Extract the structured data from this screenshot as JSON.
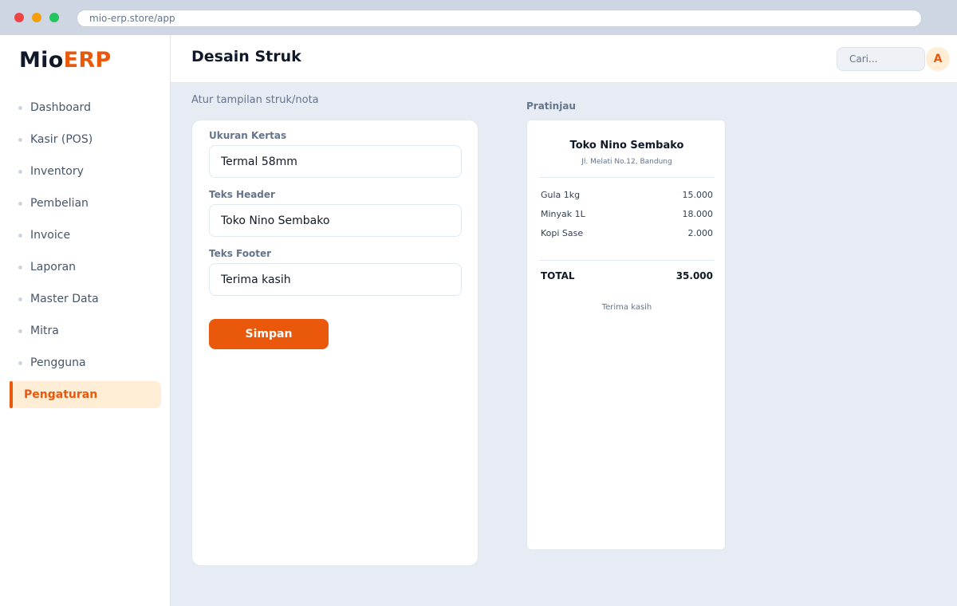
{
  "browser": {
    "url": "mio-erp.store/app"
  },
  "logo": {
    "part1": "Mio",
    "part2": "ERP"
  },
  "sidebar": {
    "items": [
      {
        "label": "Dashboard"
      },
      {
        "label": "Kasir (POS)"
      },
      {
        "label": "Inventory"
      },
      {
        "label": "Pembelian"
      },
      {
        "label": "Invoice"
      },
      {
        "label": "Laporan"
      },
      {
        "label": "Master Data"
      },
      {
        "label": "Mitra"
      },
      {
        "label": "Pengguna"
      },
      {
        "label": "Pengaturan",
        "active": true
      }
    ]
  },
  "header": {
    "title": "Desain Struk",
    "search_placeholder": "Cari...",
    "avatar_initial": "A"
  },
  "main": {
    "subtitle": "Atur tampilan struk/nota",
    "preview_title": "Pratinjau"
  },
  "form": {
    "paper_size": {
      "label": "Ukuran Kertas",
      "value": "Termal 58mm"
    },
    "header_text": {
      "label": "Teks Header",
      "value": "Toko Nino Sembako"
    },
    "footer_text": {
      "label": "Teks Footer",
      "value": "Terima kasih"
    },
    "save_label": "Simpan"
  },
  "receipt": {
    "store_name": "Toko Nino Sembako",
    "address": "Jl. Melati No.12, Bandung",
    "items": [
      {
        "name": "Gula 1kg",
        "price": "15.000"
      },
      {
        "name": "Minyak 1L",
        "price": "18.000"
      },
      {
        "name": "Kopi Sase",
        "price": "2.000"
      }
    ],
    "total_label": "TOTAL",
    "total_value": "35.000",
    "footer": "Terima kasih"
  },
  "colors": {
    "accent": "#ea580c",
    "accent_soft": "#ffedd5",
    "background": "#e7ecf4"
  }
}
